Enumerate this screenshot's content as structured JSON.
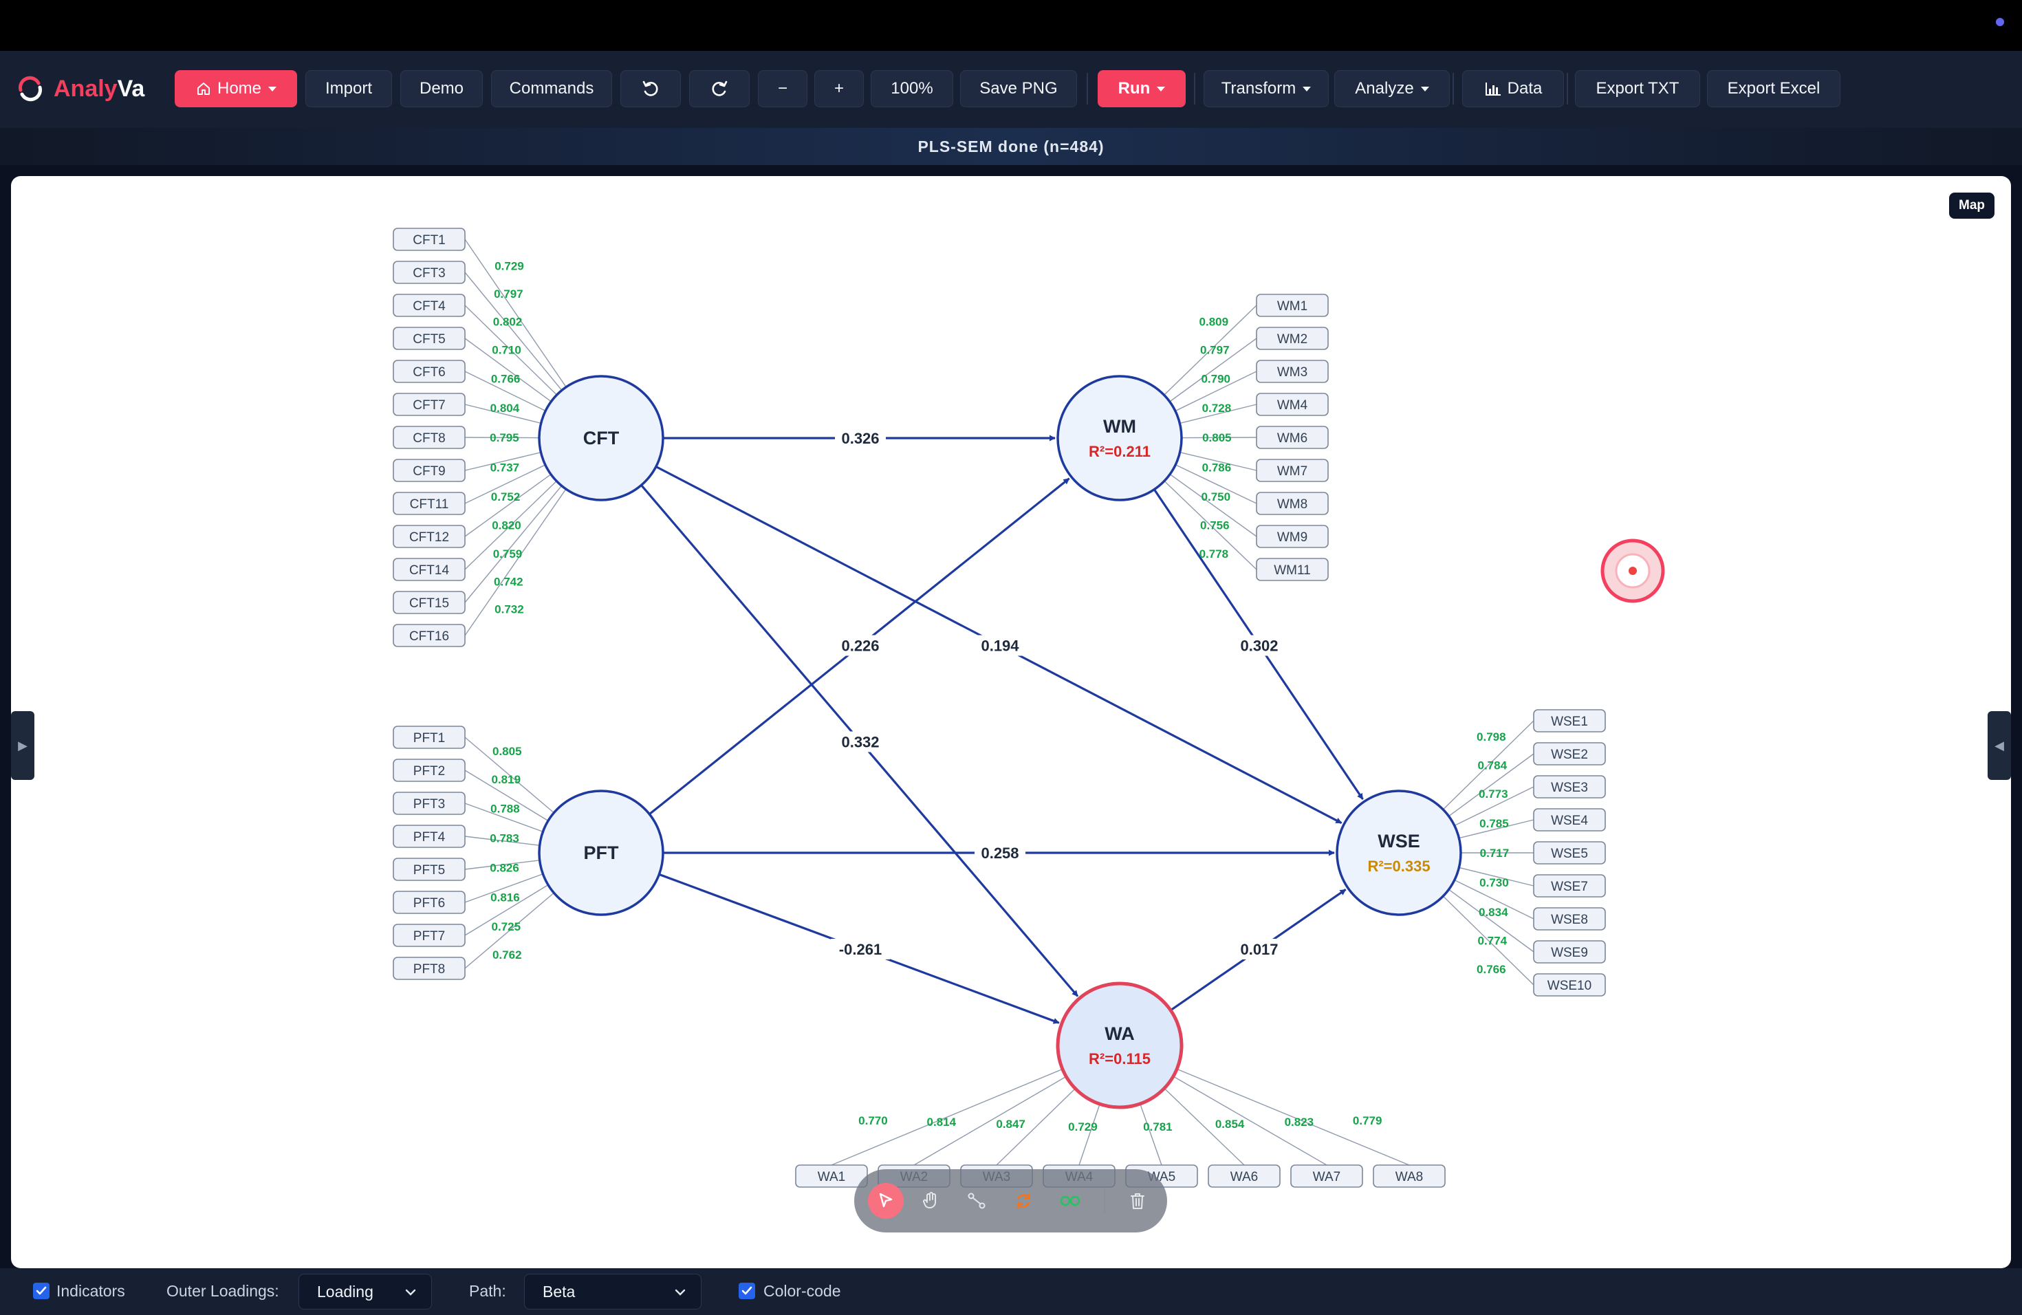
{
  "app": {
    "brand_a": "Analy",
    "brand_b": "Va",
    "status": "PLS-SEM done (n=484)"
  },
  "toolbar": {
    "home": "Home",
    "import": "Import",
    "demo": "Demo",
    "commands": "Commands",
    "undo_icon": "undo-icon",
    "redo_icon": "redo-icon",
    "zoom_out": "−",
    "zoom_in": "+",
    "zoom": "100%",
    "save_png": "Save PNG",
    "run": "Run",
    "transform": "Transform",
    "analyze": "Analyze",
    "data": "Data",
    "export_txt": "Export TXT",
    "export_excel": "Export Excel"
  },
  "canvas": {
    "map_label": "Map",
    "left_toggle": "▶",
    "right_toggle": "◀"
  },
  "tools": [
    "select-tool-icon",
    "hand-tool-icon",
    "connect-tool-icon",
    "refresh-tool-icon",
    "link-tool-icon",
    "delete-tool-icon"
  ],
  "bottom": {
    "indicators_label": "Indicators",
    "indicators_checked": true,
    "outer_loadings_label": "Outer Loadings:",
    "outer_loadings_value": "Loading",
    "path_label": "Path:",
    "path_value": "Beta",
    "color_code_label": "Color-code",
    "color_code_checked": true
  },
  "colors": {
    "accent": "#f43f5e",
    "path": "#1e3a9e",
    "loading": "#16a34a",
    "node_fill": "#edf3fd",
    "r2_red": "#dc2626",
    "r2_amber": "#ca8a04"
  },
  "model": {
    "constructs": [
      {
        "id": "CFT",
        "r2": ""
      },
      {
        "id": "WM",
        "r2": "R²=0.211",
        "r2_color": "#dc2626"
      },
      {
        "id": "PFT",
        "r2": ""
      },
      {
        "id": "WSE",
        "r2": "R²=0.335",
        "r2_color": "#ca8a04"
      },
      {
        "id": "WA",
        "r2": "R²=0.115",
        "r2_color": "#dc2626",
        "highlight": true
      }
    ],
    "paths": [
      {
        "from": "CFT",
        "to": "WM",
        "beta": "0.326"
      },
      {
        "from": "PFT",
        "to": "WM",
        "beta": "0.226"
      },
      {
        "from": "CFT",
        "to": "WSE",
        "beta": "0.194"
      },
      {
        "from": "WM",
        "to": "WSE",
        "beta": "0.302"
      },
      {
        "from": "CFT",
        "to": "WA",
        "beta": "0.332"
      },
      {
        "from": "PFT",
        "to": "WSE",
        "beta": "0.258"
      },
      {
        "from": "PFT",
        "to": "WA",
        "beta": "-0.261"
      },
      {
        "from": "WA",
        "to": "WSE",
        "beta": "0.017"
      }
    ],
    "indicators": {
      "CFT": {
        "items": [
          "CFT1",
          "CFT3",
          "CFT4",
          "CFT5",
          "CFT6",
          "CFT7",
          "CFT8",
          "CFT9",
          "CFT11",
          "CFT12",
          "CFT14",
          "CFT15",
          "CFT16"
        ],
        "loadings": [
          "0.729",
          "0.797",
          "0.802",
          "0.710",
          "0.766",
          "0.804",
          "0.795",
          "0.737",
          "0.752",
          "0.820",
          "0.759",
          "0.742",
          "0.732"
        ]
      },
      "PFT": {
        "items": [
          "PFT1",
          "PFT2",
          "PFT3",
          "PFT4",
          "PFT5",
          "PFT6",
          "PFT7",
          "PFT8"
        ],
        "loadings": [
          "0.805",
          "0.819",
          "0.788",
          "0.783",
          "0.826",
          "0.816",
          "0.725",
          "0.762"
        ]
      },
      "WM": {
        "items": [
          "WM1",
          "WM2",
          "WM3",
          "WM4",
          "WM6",
          "WM7",
          "WM8",
          "WM9",
          "WM11"
        ],
        "loadings": [
          "0.809",
          "0.797",
          "0.790",
          "0.728",
          "0.805",
          "0.786",
          "0.750",
          "0.756",
          "0.778"
        ]
      },
      "WSE": {
        "items": [
          "WSE1",
          "WSE2",
          "WSE3",
          "WSE4",
          "WSE5",
          "WSE7",
          "WSE8",
          "WSE9",
          "WSE10"
        ],
        "loadings": [
          "0.798",
          "0.784",
          "0.773",
          "0.785",
          "0.717",
          "0.730",
          "0.834",
          "0.774",
          "0.766"
        ]
      },
      "WA": {
        "items": [
          "WA1",
          "WA2",
          "WA3",
          "WA4",
          "WA5",
          "WA6",
          "WA7",
          "WA8"
        ],
        "loadings": [
          "0.770",
          "0.814",
          "0.847",
          "0.729",
          "0.781",
          "0.854",
          "0.823",
          "0.779"
        ]
      }
    }
  }
}
